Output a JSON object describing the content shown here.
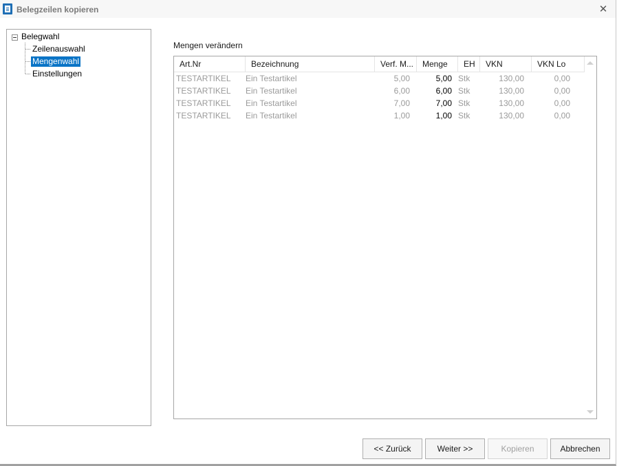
{
  "window": {
    "title": "Belegzeilen kopieren",
    "close_symbol": "✕",
    "icon": "document-icon"
  },
  "tree": {
    "root": "Belegwahl",
    "items": [
      {
        "label": "Zeilenauswahl",
        "selected": false
      },
      {
        "label": "Mengenwahl",
        "selected": true
      },
      {
        "label": "Einstellungen",
        "selected": false
      }
    ]
  },
  "main": {
    "section_label": "Mengen verändern",
    "columns": [
      "Art.Nr",
      "Bezeichnung",
      "Verf. M...",
      "Menge",
      "EH",
      "VKN",
      "VKN Lo"
    ],
    "rows": [
      {
        "artnr": "TESTARTIKEL",
        "bezeichnung": "Ein Testartikel",
        "verf": "5,00",
        "menge": "5,00",
        "eh": "Stk",
        "vkn": "130,00",
        "vknlo": "0,00"
      },
      {
        "artnr": "TESTARTIKEL",
        "bezeichnung": "Ein Testartikel",
        "verf": "6,00",
        "menge": "6,00",
        "eh": "Stk",
        "vkn": "130,00",
        "vknlo": "0,00"
      },
      {
        "artnr": "TESTARTIKEL",
        "bezeichnung": "Ein Testartikel",
        "verf": "7,00",
        "menge": "7,00",
        "eh": "Stk",
        "vkn": "130,00",
        "vknlo": "0,00"
      },
      {
        "artnr": "TESTARTIKEL",
        "bezeichnung": "Ein Testartikel",
        "verf": "1,00",
        "menge": "1,00",
        "eh": "Stk",
        "vkn": "130,00",
        "vknlo": "0,00"
      }
    ]
  },
  "buttons": {
    "back": "<< Zurück",
    "next": "Weiter >>",
    "copy": "Kopieren",
    "cancel": "Abbrechen"
  },
  "colors": {
    "selection": "#0a74c6",
    "icon_blue": "#1f6fb5"
  }
}
